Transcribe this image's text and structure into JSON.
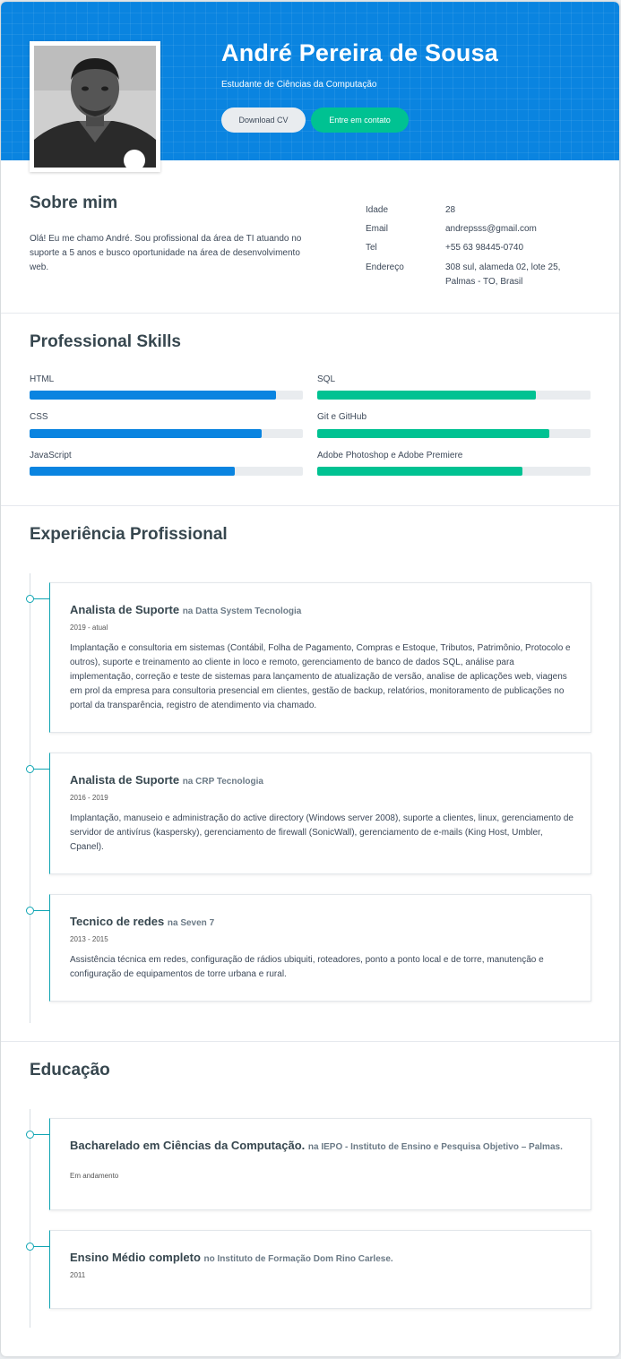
{
  "header": {
    "name": "André Pereira de Sousa",
    "subtitle": "Estudante de Ciências da Computação",
    "download_cv": "Download CV",
    "contact": "Entre em contato"
  },
  "about": {
    "title": "Sobre mim",
    "text": "Olá! Eu me chamo André. Sou profissional da área de TI atuando no suporte a 5 anos e busco oportunidade na área de desenvolvimento web.",
    "info": [
      {
        "label": "Idade",
        "value": "28"
      },
      {
        "label": "Email",
        "value": "andrepsss@gmail.com"
      },
      {
        "label": "Tel",
        "value": "+55 63 98445-0740"
      },
      {
        "label": "Endereço",
        "value": "308 sul, alameda 02, lote 25, Palmas - TO, Brasil"
      }
    ]
  },
  "skills": {
    "title": "Professional Skills",
    "left": [
      {
        "name": "HTML",
        "level": 0.9
      },
      {
        "name": "CSS",
        "level": 0.85
      },
      {
        "name": "JavaScript",
        "level": 0.75
      }
    ],
    "right": [
      {
        "name": "SQL",
        "level": 0.8
      },
      {
        "name": "Git e GitHub",
        "level": 0.85
      },
      {
        "name": "Adobe Photoshop e Adobe Premiere",
        "level": 0.75
      }
    ],
    "colors": {
      "left": "#0a84e0",
      "right": "#00c292"
    }
  },
  "experience": {
    "title": "Experiência Profissional",
    "items": [
      {
        "role": "Analista de Suporte",
        "company": "na Datta System Tecnologia",
        "period": "2019 - atual",
        "desc": "Implantação e consultoria em sistemas (Contábil, Folha de Pagamento, Compras e Estoque, Tributos, Patrimônio, Protocolo e outros), suporte e treinamento ao cliente in loco e remoto, gerenciamento de banco de dados SQL, análise para implementação, correção e teste de sistemas para lançamento de atualização de versão, analise de aplicações web, viagens em prol da empresa para consultoria presencial em clientes, gestão de backup, relatórios, monitoramento de publicações no portal da transparência, registro de atendimento via chamado."
      },
      {
        "role": "Analista de Suporte",
        "company": "na CRP Tecnologia",
        "period": "2016 - 2019",
        "desc": "Implantação, manuseio e administração do active directory (Windows server 2008), suporte a clientes, linux, gerenciamento de servidor de antivírus (kaspersky), gerenciamento de firewall (SonicWall), gerenciamento de e-mails (King Host, Umbler, Cpanel)."
      },
      {
        "role": "Tecnico de redes",
        "company": "na Seven 7",
        "period": "2013 - 2015",
        "desc": "Assistência técnica em redes, configuração de rádios ubiquiti, roteadores, ponto a ponto local e de torre, manutenção e configuração de equipamentos de torre urbana e rural."
      }
    ]
  },
  "education": {
    "title": "Educação",
    "items": [
      {
        "course": "Bacharelado em Ciências da Computação.",
        "institution": "na IEPO - Instituto de Ensino e Pesquisa Objetivo – Palmas.",
        "period": "Em andamento"
      },
      {
        "course": "Ensino Médio completo",
        "institution": "no Instituto de Formação Dom Rino Carlese.",
        "period": "2011"
      }
    ]
  }
}
